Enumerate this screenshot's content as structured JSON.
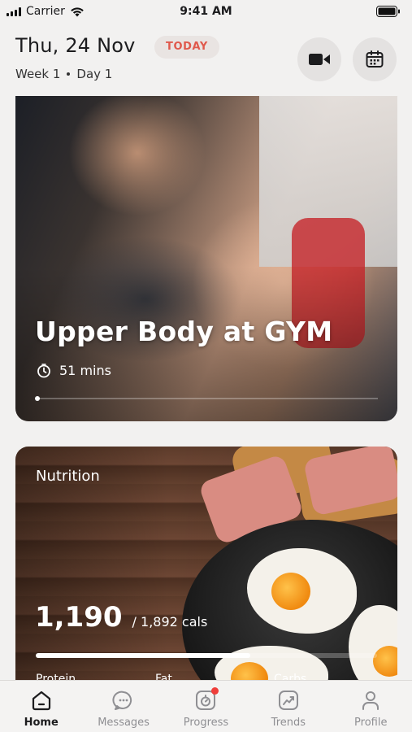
{
  "status_bar": {
    "carrier": "Carrier",
    "time": "9:41 AM"
  },
  "header": {
    "date": "Thu, 24 Nov",
    "badge": "TODAY",
    "week": "Week 1",
    "day": "Day 1",
    "buttons": [
      "video-icon",
      "calendar-icon"
    ]
  },
  "workout": {
    "title": "Upper Body at GYM",
    "duration": "51 mins",
    "progress_fraction": 0
  },
  "nutrition": {
    "label": "Nutrition",
    "calories": "1,190",
    "target": "/ 1,892 cals",
    "progress_fraction": 0.629,
    "macros": [
      "Protein",
      "Fat",
      "Carbs"
    ]
  },
  "tabs": [
    {
      "label": "Home",
      "icon": "home-icon",
      "active": true
    },
    {
      "label": "Messages",
      "icon": "messages-icon",
      "active": false
    },
    {
      "label": "Progress",
      "icon": "progress-icon",
      "active": false,
      "badge": true
    },
    {
      "label": "Trends",
      "icon": "trends-icon",
      "active": false
    },
    {
      "label": "Profile",
      "icon": "profile-icon",
      "active": false
    }
  ],
  "colors": {
    "accent": "#e0594c",
    "badge_bg": "#e9e4e2",
    "notification": "#ef3e3a"
  }
}
